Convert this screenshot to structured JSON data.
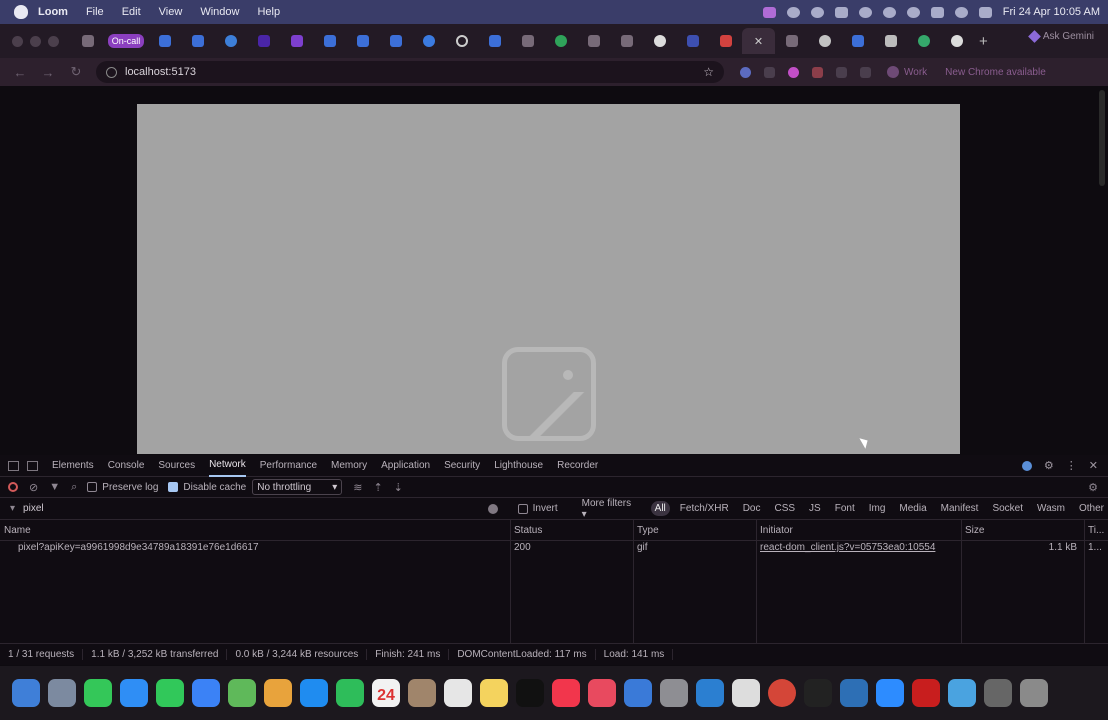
{
  "menubar": {
    "app_name": "Loom",
    "items": [
      "File",
      "Edit",
      "View",
      "Window",
      "Help"
    ],
    "datetime": "Fri 24 Apr  10:05 AM"
  },
  "tabs": {
    "oncall_label": "On-call",
    "new_tab": "+",
    "ask_gemini": "Ask Gemini",
    "icons": [
      "claude",
      "jira",
      "jira",
      "azure",
      "linear",
      "cursor",
      "jira",
      "jira",
      "jira",
      "check",
      "github-loader",
      "jira",
      "claude",
      "check-green",
      "claude",
      "claude",
      "github",
      "azure-devops",
      "pin",
      "close",
      "claude",
      "chrome",
      "jira",
      "figma",
      "circle-green",
      "github"
    ]
  },
  "address": {
    "url": "localhost:5173",
    "profile": "Work",
    "update_notice": "New Chrome available"
  },
  "devtools": {
    "tabs": [
      "Elements",
      "Console",
      "Sources",
      "Network",
      "Performance",
      "Memory",
      "Application",
      "Security",
      "Lighthouse",
      "Recorder"
    ],
    "selected_tab": "Network",
    "toolbar": {
      "preserve_log": "Preserve log",
      "disable_cache": "Disable cache",
      "throttling": "No throttling"
    },
    "filter": {
      "value": "pixel",
      "invert": "Invert",
      "more_filters": "More filters",
      "types": [
        "All",
        "Fetch/XHR",
        "Doc",
        "CSS",
        "JS",
        "Font",
        "Img",
        "Media",
        "Manifest",
        "Socket",
        "Wasm",
        "Other"
      ]
    },
    "columns": [
      "Name",
      "Status",
      "Type",
      "Initiator",
      "Size",
      "Ti..."
    ],
    "rows": [
      {
        "name": "pixel?apiKey=a9961998d9e34789a18391e76e1d6617",
        "status": "200",
        "type": "gif",
        "initiator": "react-dom_client.js?v=05753ea0:10554",
        "size": "1.1 kB",
        "time": "1..."
      }
    ],
    "summary": {
      "requests": "1 / 31 requests",
      "transferred": "1.1 kB / 3,252 kB transferred",
      "resources": "0.0 kB / 3,244 kB resources",
      "finish": "Finish: 241 ms",
      "dcl": "DOMContentLoaded: 117 ms",
      "load": "Load: 141 ms"
    }
  },
  "dock": {
    "apps": [
      "finder",
      "launchpad",
      "phone",
      "safari",
      "messages",
      "mail",
      "maps",
      "photos",
      "app-store",
      "facetime",
      "calendar",
      "contacts",
      "reminders",
      "notes",
      "apple-tv",
      "music",
      "rocket",
      "keynote",
      "settings",
      "vscode",
      "slack",
      "chrome",
      "terminal",
      "docker",
      "zoom",
      "acrobat",
      "sketch",
      "downloads",
      "trash"
    ],
    "calendar_day": "24"
  },
  "colors": {
    "menubar": "#3a3d69",
    "tabbar": "#231a25",
    "devtools_bg": "#100c12",
    "placeholder_gray": "#a3a3a3",
    "oncall_badge": "#8b3fbf"
  }
}
